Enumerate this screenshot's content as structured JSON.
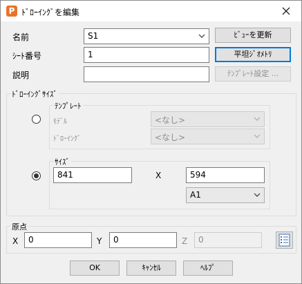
{
  "window": {
    "title": "ﾄﾞﾛｰｲﾝｸﾞを編集",
    "app_icon_letter": "P"
  },
  "name_field": {
    "label": "名前",
    "value": "S1"
  },
  "sheet_field": {
    "label": "ｼｰﾄ番号",
    "value": "1"
  },
  "description_field": {
    "label": "説明",
    "value": ""
  },
  "buttons": {
    "update_view": "ﾋﾞｭｰを更新",
    "flat_geometry": "平坦ｼﾞｵﾒﾄﾘ",
    "template_settings": "ﾃﾝﾌﾟﾚｰﾄ設定 ..."
  },
  "drawing_size": {
    "title": "ﾄﾞﾛｰｲﾝｸﾞｻｲｽﾞ",
    "template_group": {
      "title": "ﾃﾝﾌﾟﾚｰﾄ",
      "model_label": "ﾓﾃﾞﾙ",
      "model_value": "<なし>",
      "drawing_label": "ﾄﾞﾛｰｲﾝｸﾞ",
      "drawing_value": "<なし>",
      "selected": false
    },
    "size_group": {
      "title": "ｻｲｽﾞ",
      "width": "841",
      "x_label": "X",
      "height": "594",
      "paper": "A1",
      "selected": true
    }
  },
  "origin": {
    "title": "原点",
    "x_label": "X",
    "x_value": "0",
    "y_label": "Y",
    "y_value": "0",
    "z_label": "Z",
    "z_value": "0"
  },
  "footer": {
    "ok": "OK",
    "cancel": "ｷｬﾝｾﾙ",
    "help": "ﾍﾙﾌﾟ"
  }
}
